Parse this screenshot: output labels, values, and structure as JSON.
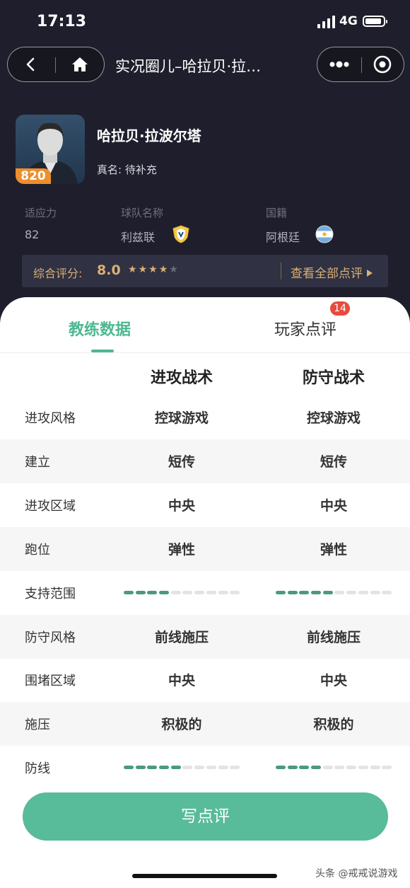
{
  "status": {
    "time": "17:13",
    "network": "4G"
  },
  "nav": {
    "title": "实况圈儿–哈拉贝·拉…"
  },
  "player": {
    "name": "哈拉贝·拉波尔塔",
    "real_name": "真名: 待补充",
    "overall": "820"
  },
  "info": [
    {
      "label": "适应力",
      "value": "82"
    },
    {
      "label": "球队名称",
      "value": "利兹联"
    },
    {
      "label": "国籍",
      "value": "阿根廷"
    }
  ],
  "rating": {
    "label": "综合评分:",
    "value": "8.0",
    "stars_filled": 4,
    "stars_total": 5,
    "view_all": "查看全部点评",
    "view_all_icon": "triangle-right-icon"
  },
  "tabs": [
    {
      "label": "教练数据",
      "active": true
    },
    {
      "label": "玩家点评",
      "badge": "14"
    }
  ],
  "columns": [
    "进攻战术",
    "防守战术"
  ],
  "rows": [
    {
      "label": "进攻风格",
      "attack": "控球游戏",
      "defense": "控球游戏"
    },
    {
      "label": "建立",
      "attack": "短传",
      "defense": "短传"
    },
    {
      "label": "进攻区域",
      "attack": "中央",
      "defense": "中央"
    },
    {
      "label": "跑位",
      "attack": "弹性",
      "defense": "弹性"
    },
    {
      "label": "支持范围",
      "attack_level": 4,
      "defense_level": 5,
      "level_max": 10
    },
    {
      "label": "防守风格",
      "attack": "前线施压",
      "defense": "前线施压"
    },
    {
      "label": "围堵区域",
      "attack": "中央",
      "defense": "中央"
    },
    {
      "label": "施压",
      "attack": "积极的",
      "defense": "积极的"
    },
    {
      "label": "防线",
      "attack_level": 5,
      "defense_level": 4,
      "level_max": 10
    }
  ],
  "write_button": "写点评",
  "watermark": "头条 @戒戒说游戏",
  "colors": {
    "accent": "#4cb891",
    "gold": "#d9b176",
    "dark_bg": "#1e1e2c",
    "badge_red": "#e74b3c"
  }
}
